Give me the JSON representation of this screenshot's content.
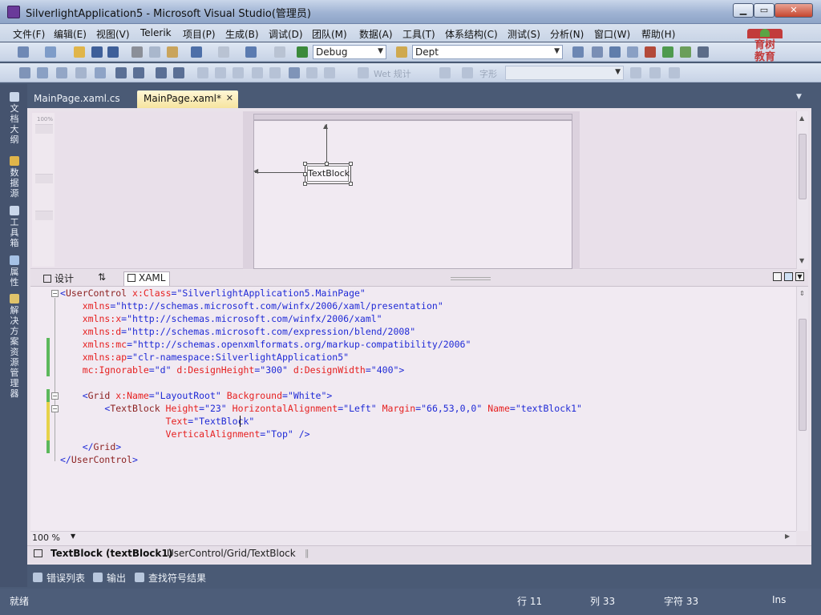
{
  "window": {
    "title": "SilverlightApplication5 - Microsoft Visual Studio(管理员)",
    "minimize_icon": "minimize-icon",
    "maximize_icon": "maximize-icon",
    "close_icon": "close-icon"
  },
  "menubar": {
    "items": [
      "文件(F)",
      "编辑(E)",
      "视图(V)",
      "Telerik",
      "项目(P)",
      "生成(B)",
      "调试(D)",
      "团队(M)",
      "数据(A)",
      "工具(T)",
      "体系结构(C)",
      "测试(S)",
      "分析(N)",
      "窗口(W)",
      "帮助(H)"
    ]
  },
  "toolbar": {
    "config_combo": "Debug",
    "platform_combo": "Dept",
    "font_combo_placeholder": "Wet 规计",
    "size_combo_placeholder": "字形"
  },
  "logo": {
    "text": "育树\n教育"
  },
  "sidebar": {
    "items": [
      {
        "label": "文档大纲",
        "icon": "document-outline-icon"
      },
      {
        "label": "数据源",
        "icon": "data-source-icon"
      },
      {
        "label": "工具箱",
        "icon": "toolbox-icon"
      },
      {
        "label": "属性",
        "icon": "properties-icon"
      },
      {
        "label": "解决方案资源管理器",
        "icon": "solution-explorer-icon"
      }
    ]
  },
  "doc_tabs": {
    "tab1": "MainPage.xaml.cs",
    "tab2": "MainPage.xaml*",
    "close_glyph": "✕"
  },
  "design": {
    "ruler_zoom": "100%",
    "textblock_label": "TextBlock"
  },
  "view_tabs": {
    "design": "设计",
    "swap": "⇅",
    "xaml": "XAML"
  },
  "code": {
    "lines": [
      [
        [
          "pn",
          "<"
        ],
        [
          "el",
          "UserControl"
        ],
        [
          "at",
          " x:Class"
        ],
        [
          "pn",
          "="
        ],
        [
          "vl",
          "\"SilverlightApplication5.MainPage\""
        ]
      ],
      [
        [
          "at",
          "    xmlns"
        ],
        [
          "pn",
          "="
        ],
        [
          "vl",
          "\"http://schemas.microsoft.com/winfx/2006/xaml/presentation\""
        ]
      ],
      [
        [
          "at",
          "    xmlns:x"
        ],
        [
          "pn",
          "="
        ],
        [
          "vl",
          "\"http://schemas.microsoft.com/winfx/2006/xaml\""
        ]
      ],
      [
        [
          "at",
          "    xmlns:d"
        ],
        [
          "pn",
          "="
        ],
        [
          "vl",
          "\"http://schemas.microsoft.com/expression/blend/2008\""
        ]
      ],
      [
        [
          "at",
          "    xmlns:mc"
        ],
        [
          "pn",
          "="
        ],
        [
          "vl",
          "\"http://schemas.openxmlformats.org/markup-compatibility/2006\""
        ]
      ],
      [
        [
          "at",
          "    xmlns:ap"
        ],
        [
          "pn",
          "="
        ],
        [
          "vl",
          "\"clr-namespace:SilverlightApplication5\""
        ]
      ],
      [
        [
          "at",
          "    mc:Ignorable"
        ],
        [
          "pn",
          "="
        ],
        [
          "vl",
          "\"d\""
        ],
        [
          "at",
          " d:DesignHeight"
        ],
        [
          "pn",
          "="
        ],
        [
          "vl",
          "\"300\""
        ],
        [
          "at",
          " d:DesignWidth"
        ],
        [
          "pn",
          "="
        ],
        [
          "vl",
          "\"400\""
        ],
        [
          "pn",
          ">"
        ]
      ],
      [
        [
          "pn",
          ""
        ]
      ],
      [
        [
          "pn",
          "    <"
        ],
        [
          "el",
          "Grid"
        ],
        [
          "at",
          " x:Name"
        ],
        [
          "pn",
          "="
        ],
        [
          "vl",
          "\"LayoutRoot\""
        ],
        [
          "at",
          " Background"
        ],
        [
          "pn",
          "="
        ],
        [
          "vl",
          "\"White\""
        ],
        [
          "pn",
          ">"
        ]
      ],
      [
        [
          "pn",
          "        <"
        ],
        [
          "el",
          "TextBlock"
        ],
        [
          "at",
          " Height"
        ],
        [
          "pn",
          "="
        ],
        [
          "vl",
          "\"23\""
        ],
        [
          "at",
          " HorizontalAlignment"
        ],
        [
          "pn",
          "="
        ],
        [
          "vl",
          "\"Left\""
        ],
        [
          "at",
          " Margin"
        ],
        [
          "pn",
          "="
        ],
        [
          "vl",
          "\"66,53,0,0\""
        ],
        [
          "at",
          " Name"
        ],
        [
          "pn",
          "="
        ],
        [
          "vl",
          "\"textBlock1\""
        ]
      ],
      [
        [
          "at",
          "                   Text"
        ],
        [
          "pn",
          "="
        ],
        [
          "vl",
          "\"TextBlock\""
        ]
      ],
      [
        [
          "at",
          "                   VerticalAlignment"
        ],
        [
          "pn",
          "="
        ],
        [
          "vl",
          "\"Top\""
        ],
        [
          "pn",
          " />"
        ]
      ],
      [
        [
          "pn",
          "    </"
        ],
        [
          "el",
          "Grid"
        ],
        [
          "pn",
          ">"
        ]
      ],
      [
        [
          "pn",
          "</"
        ],
        [
          "el",
          "UserControl"
        ],
        [
          "pn",
          ">"
        ]
      ]
    ]
  },
  "zoom": {
    "value": "100 %"
  },
  "breadcrumb": {
    "current": "TextBlock (textBlock1)",
    "path": "UserControl/Grid/TextBlock",
    "separator": "‖"
  },
  "bottom_tabs": [
    {
      "label": "错误列表",
      "icon": "error-list-icon"
    },
    {
      "label": "输出",
      "icon": "output-icon"
    },
    {
      "label": "查找符号结果",
      "icon": "find-symbol-icon"
    }
  ],
  "statusbar": {
    "ready": "就绪",
    "line": "行 11",
    "col": "列 33",
    "char": "字符 33",
    "mode": "Ins"
  }
}
